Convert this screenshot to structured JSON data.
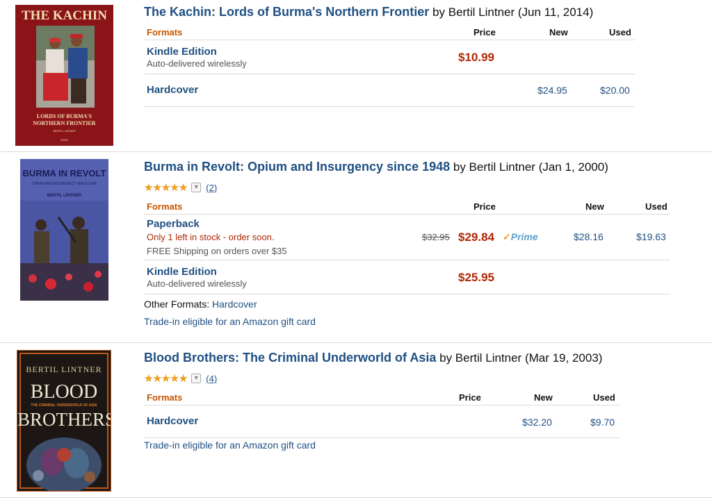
{
  "results": [
    {
      "cover": {
        "title_text": "THE KACHIN",
        "sub_text": "LORDS OF BURMA'S NORTHERN FRONTIER",
        "author_small": "BERTIL LINTNER",
        "publisher_small": "AFNA"
      },
      "title": "The Kachin: Lords of Burma's Northern Frontier",
      "byline": "by Bertil Lintner (Jun 11, 2014)",
      "headers": {
        "formats": "Formats",
        "price": "Price",
        "new": "New",
        "used": "Used"
      },
      "rows": [
        {
          "format": "Kindle Edition",
          "sub": "Auto-delivered wirelessly",
          "price": "$10.99"
        },
        {
          "format": "Hardcover",
          "new": "$24.95",
          "used": "$20.00"
        }
      ]
    },
    {
      "cover": {
        "title_text": "BURMA IN REVOLT",
        "sub_text": "OPIUM AND INSURGENCY SINCE 1948",
        "author_small": "BERTIL LINTNER"
      },
      "title": "Burma in Revolt: Opium and Insurgency since 1948",
      "byline": "by Bertil Lintner (Jan 1, 2000)",
      "rating": {
        "stars": 5,
        "count": "(2)"
      },
      "headers": {
        "formats": "Formats",
        "price": "Price",
        "new": "New",
        "used": "Used"
      },
      "rows": [
        {
          "format": "Paperback",
          "sub": "Only 1 left in stock - order soon.",
          "sub2": "FREE Shipping on orders over $35",
          "list_price": "$32.95",
          "price": "$29.84",
          "prime": "Prime",
          "new": "$28.16",
          "used": "$19.63"
        },
        {
          "format": "Kindle Edition",
          "sub": "Auto-delivered wirelessly",
          "price": "$25.95"
        }
      ],
      "other_formats_label": "Other Formats:",
      "other_formats_link": "Hardcover",
      "tradein": "Trade-in eligible for an Amazon gift card"
    },
    {
      "cover": {
        "author_text": "BERTIL LINTNER",
        "title_text_1": "BLOOD",
        "sub_text": "THE CRIMINAL UNDERWORLD OF ASIA",
        "title_text_2": "BROTHERS"
      },
      "title": "Blood Brothers: The Criminal Underworld of Asia",
      "byline": "by Bertil Lintner (Mar 19, 2003)",
      "rating": {
        "stars": 5,
        "count": "(4)"
      },
      "headers": {
        "formats": "Formats",
        "price": "Price",
        "new": "New",
        "used": "Used"
      },
      "rows": [
        {
          "format": "Hardcover",
          "new": "$32.20",
          "used": "$9.70"
        }
      ],
      "tradein": "Trade-in eligible for an Amazon gift card"
    }
  ],
  "colors": {
    "link": "#1f4f82",
    "price": "#b12704",
    "formats_header": "#c45500",
    "star": "#f0a020"
  },
  "icons": {
    "star": "star-icon",
    "dropdown": "chevron-down-icon",
    "prime": "prime-logo"
  }
}
